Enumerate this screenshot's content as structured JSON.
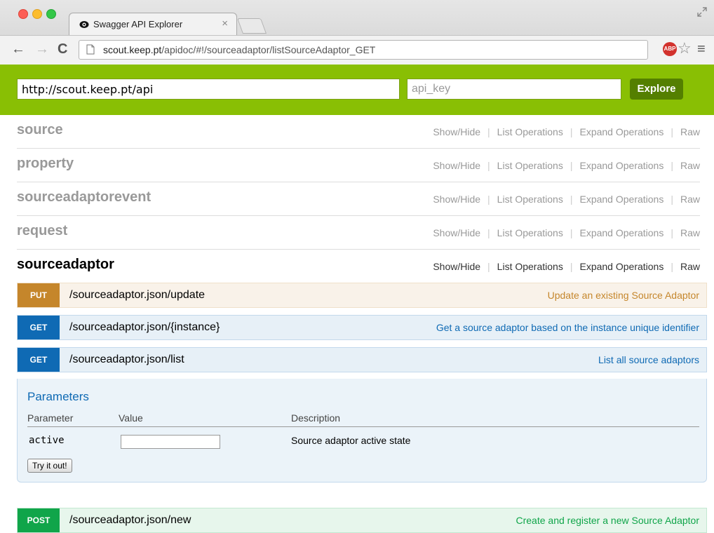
{
  "browser": {
    "tab_title": "Swagger API Explorer",
    "tab_close": "×",
    "url_host": "scout.keep.pt",
    "url_path": "/apidoc/#!/sourceadaptor/listSourceAdaptor_GET",
    "nav_back": "←",
    "nav_forward": "→",
    "nav_reload": "C",
    "abp_label": "ABP",
    "star": "☆",
    "menu": "≡"
  },
  "header": {
    "base_url": "http://scout.keep.pt/api",
    "api_key_placeholder": "api_key",
    "explore_label": "Explore",
    "brand_color": "#89bf04"
  },
  "resource_ops": {
    "show_hide": "Show/Hide",
    "list_operations": "List Operations",
    "expand_operations": "Expand Operations",
    "raw": "Raw"
  },
  "resources": [
    {
      "name": "source"
    },
    {
      "name": "property"
    },
    {
      "name": "sourceadaptorevent"
    },
    {
      "name": "request"
    },
    {
      "name": "sourceadaptor"
    }
  ],
  "operations": [
    {
      "method": "PUT",
      "path": "/sourceadaptor.json/update",
      "summary": "Update an existing Source Adaptor"
    },
    {
      "method": "GET",
      "path": "/sourceadaptor.json/{instance}",
      "summary": "Get a source adaptor based on the instance unique identifier"
    },
    {
      "method": "GET",
      "path": "/sourceadaptor.json/list",
      "summary": "List all source adaptors"
    },
    {
      "method": "POST",
      "path": "/sourceadaptor.json/new",
      "summary": "Create and register a new Source Adaptor"
    }
  ],
  "parameters": {
    "title": "Parameters",
    "col_parameter": "Parameter",
    "col_value": "Value",
    "col_description": "Description",
    "rows": [
      {
        "name": "active",
        "value": "",
        "description": "Source adaptor active state"
      }
    ],
    "try_label": "Try it out!"
  }
}
